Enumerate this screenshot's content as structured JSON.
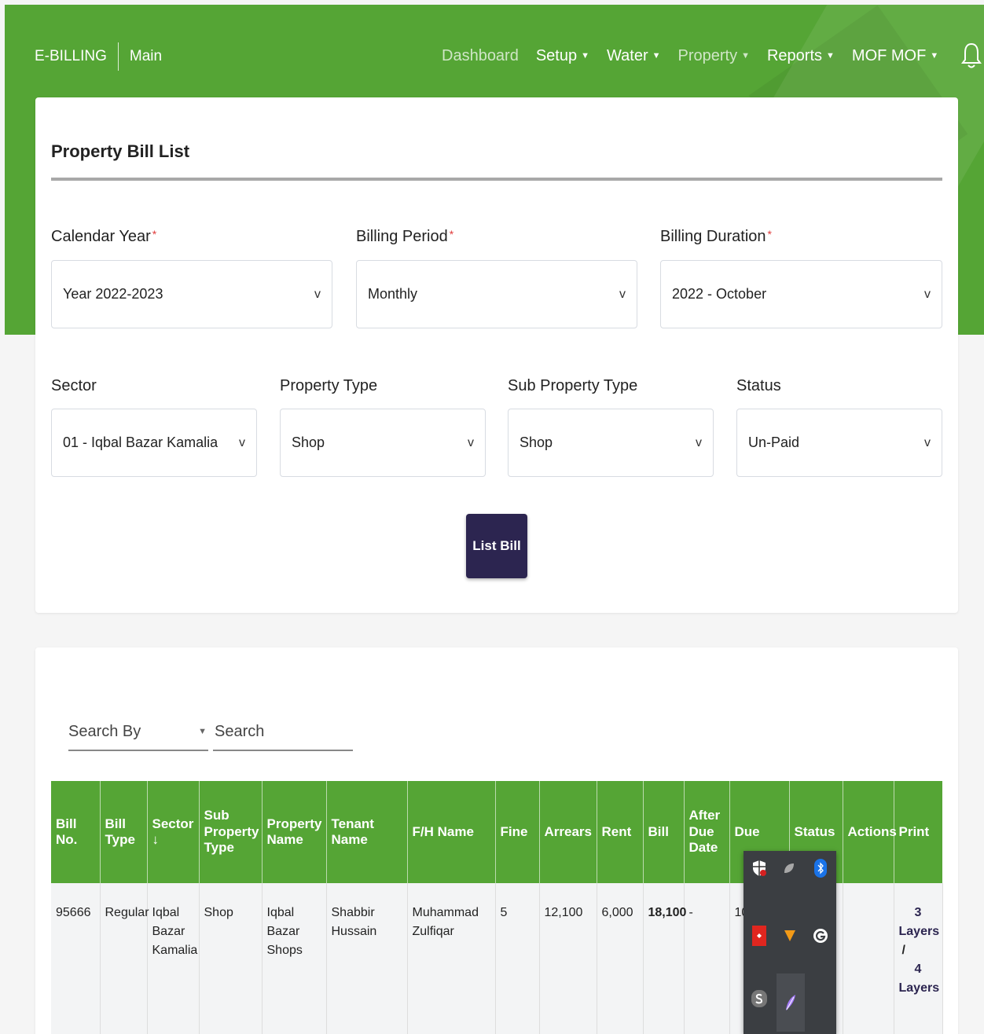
{
  "header": {
    "brand": "E-BILLING",
    "section": "Main",
    "nav": [
      {
        "label": "Dashboard",
        "has_caret": false
      },
      {
        "label": "Setup",
        "has_caret": true
      },
      {
        "label": "Water",
        "has_caret": true
      },
      {
        "label": "Property",
        "has_caret": true
      },
      {
        "label": "Reports",
        "has_caret": true
      },
      {
        "label": "MOF MOF",
        "has_caret": true
      }
    ],
    "caret_glyph": "▼",
    "icons": [
      "bell-icon",
      "logout-icon"
    ],
    "color": "#55a535"
  },
  "filters": {
    "title": "Property Bill List",
    "calendar_year": {
      "label": "Calendar Year",
      "required": "*",
      "value": "Year 2022-2023"
    },
    "billing_period": {
      "label": "Billing Period",
      "required": "*",
      "value": "Monthly"
    },
    "billing_duration": {
      "label": "Billing Duration",
      "required": "*",
      "value": "2022 - October"
    },
    "sector": {
      "label": "Sector",
      "value": "01 - Iqbal Bazar Kamalia"
    },
    "property_type": {
      "label": "Property Type",
      "value": "Shop"
    },
    "sub_property_type": {
      "label": "Sub Property Type",
      "value": "Shop"
    },
    "status": {
      "label": "Status",
      "value": "Un-Paid"
    },
    "chevron": "v",
    "list_button": "List Bill"
  },
  "results": {
    "search_by": {
      "label": "Search By",
      "arrow": "▼"
    },
    "search_placeholder": "Search",
    "columns": [
      "Bill No.",
      "Bill Type",
      "Sector ↓",
      "Sub Property Type",
      "Property Name",
      "Tenant Name",
      "F/H Name",
      "Fine",
      "Arrears",
      "Rent",
      "Bill",
      "After Due Date",
      "Due",
      "Status",
      "Actions",
      "Print"
    ],
    "rows": [
      {
        "bill_no": "95666",
        "bill_type": "Regular",
        "sector": "Iqbal Bazar Kamalia",
        "sub_property_type": "Shop",
        "property_name": "Iqbal Bazar Shops",
        "tenant_name": "Shabbir Hussain",
        "fh_name": "Muhammad Zulfiqar",
        "fine": "5",
        "arrears": "12,100",
        "rent": "6,000",
        "bill": "18,100",
        "after_due_date": "-",
        "due": "10",
        "status": "",
        "actions": "",
        "print": {
          "layers3_num": "3",
          "layers3_word": "Layers",
          "sep": "/",
          "layers4_num": "4",
          "layers4_word": "Layers"
        }
      }
    ]
  },
  "tray": {
    "icons": [
      "shield-error-icon",
      "leaf-icon",
      "bluetooth-icon",
      "red-app-icon",
      "orange-app-icon",
      "g-app-icon",
      "s-app-icon",
      "feather-icon"
    ]
  }
}
